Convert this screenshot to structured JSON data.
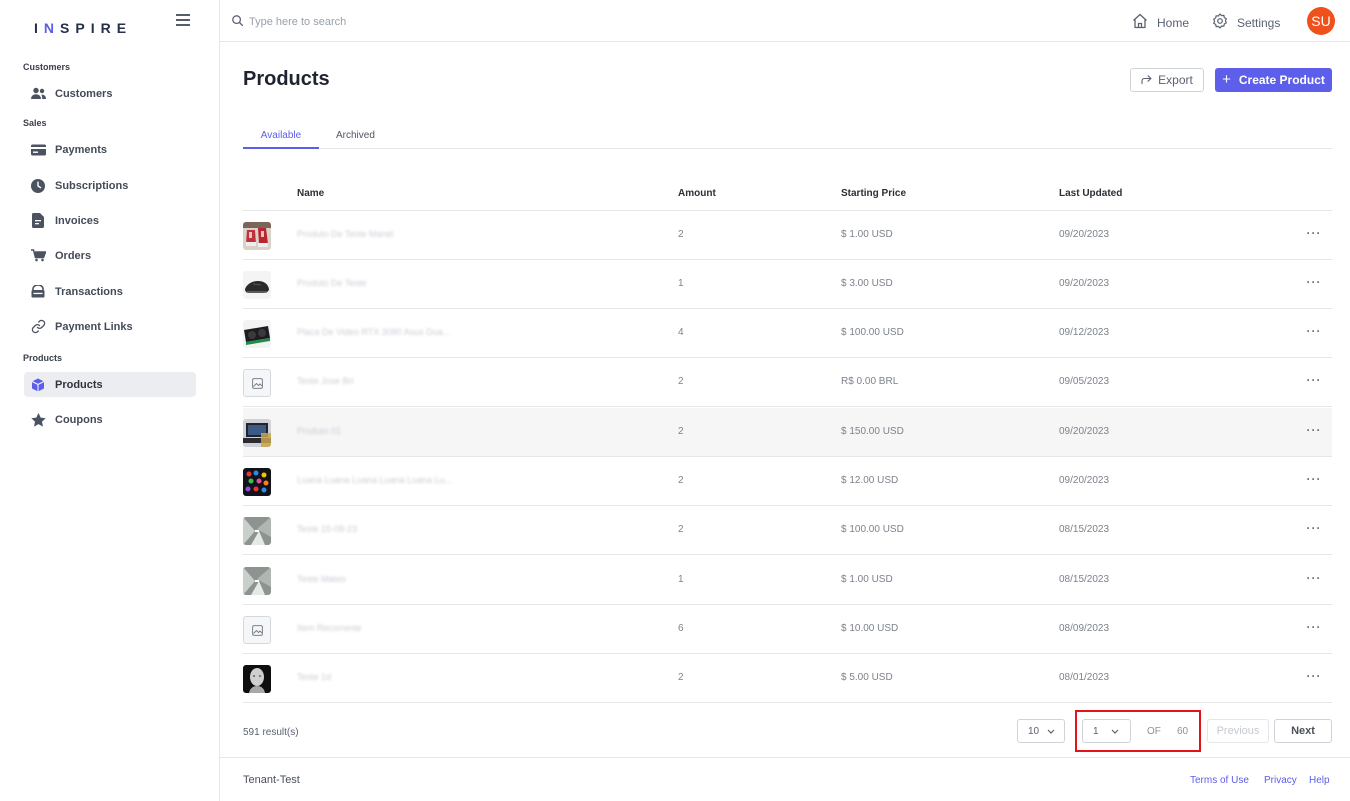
{
  "brand": {
    "logo_pre": "I",
    "logo_hl": "N",
    "logo_post": "SPIRE"
  },
  "sidebar": {
    "sections": [
      "Customers",
      "Sales",
      "Products"
    ],
    "items": [
      {
        "label": "Customers",
        "icon": "users-icon"
      },
      {
        "label": "Payments",
        "icon": "credit-card-icon"
      },
      {
        "label": "Subscriptions",
        "icon": "clock-icon"
      },
      {
        "label": "Invoices",
        "icon": "document-icon"
      },
      {
        "label": "Orders",
        "icon": "cart-icon"
      },
      {
        "label": "Transactions",
        "icon": "transactions-icon"
      },
      {
        "label": "Payment Links",
        "icon": "link-icon"
      },
      {
        "label": "Products",
        "icon": "cube-icon",
        "active": true
      },
      {
        "label": "Coupons",
        "icon": "star-icon"
      }
    ]
  },
  "header": {
    "search_placeholder": "Type here to search",
    "home_label": "Home",
    "settings_label": "Settings",
    "avatar_initials": "SU",
    "avatar_color": "#f0501c"
  },
  "page": {
    "title": "Products",
    "export_label": "Export",
    "create_label": "Create Product",
    "tabs": [
      {
        "label": "Available",
        "active": true
      },
      {
        "label": "Archived",
        "active": false
      }
    ]
  },
  "table": {
    "columns": [
      "Name",
      "Amount",
      "Starting Price",
      "Last Updated"
    ],
    "rows": [
      {
        "name": "Produto De Teste Manel",
        "amount": "2",
        "price": "$ 1.00 USD",
        "updated": "09/20/2023",
        "thumb": "shoes-red"
      },
      {
        "name": "Produto De Teste",
        "amount": "1",
        "price": "$ 3.00 USD",
        "updated": "09/20/2023",
        "thumb": "shoe-black"
      },
      {
        "name": "Placa De Video RTX 3080 Asus Dua...",
        "amount": "4",
        "price": "$ 100.00 USD",
        "updated": "09/12/2023",
        "thumb": "gpu"
      },
      {
        "name": "Teste Jose Bri",
        "amount": "2",
        "price": "R$ 0.00 BRL",
        "updated": "09/05/2023",
        "thumb": "placeholder"
      },
      {
        "name": "Produto 01",
        "amount": "2",
        "price": "$ 150.00 USD",
        "updated": "09/20/2023",
        "thumb": "laptop"
      },
      {
        "name": "Luana Luana Luana Luana Luana Lu...",
        "amount": "2",
        "price": "$ 12.00 USD",
        "updated": "09/20/2023",
        "thumb": "candy"
      },
      {
        "name": "Teste 15-08-23",
        "amount": "2",
        "price": "$ 100.00 USD",
        "updated": "08/15/2023",
        "thumb": "ice"
      },
      {
        "name": "Teste Mateo",
        "amount": "1",
        "price": "$ 1.00 USD",
        "updated": "08/15/2023",
        "thumb": "ice"
      },
      {
        "name": "Item Recorrente",
        "amount": "6",
        "price": "$ 10.00 USD",
        "updated": "08/09/2023",
        "thumb": "placeholder"
      },
      {
        "name": "Teste 1d",
        "amount": "2",
        "price": "$ 5.00 USD",
        "updated": "08/01/2023",
        "thumb": "face"
      }
    ],
    "more_icon": "more-horizontal-icon"
  },
  "pagination": {
    "results": "591 result(s)",
    "page_size": "10",
    "current_page": "1",
    "of_label": "OF",
    "total_pages": "60",
    "previous_label": "Previous",
    "next_label": "Next"
  },
  "footer": {
    "tenant": "Tenant-Test",
    "terms": "Terms of Use",
    "privacy": "Privacy",
    "help": "Help"
  },
  "colors": {
    "accent": "#5d5ee9",
    "highlight": "#e3131b"
  }
}
